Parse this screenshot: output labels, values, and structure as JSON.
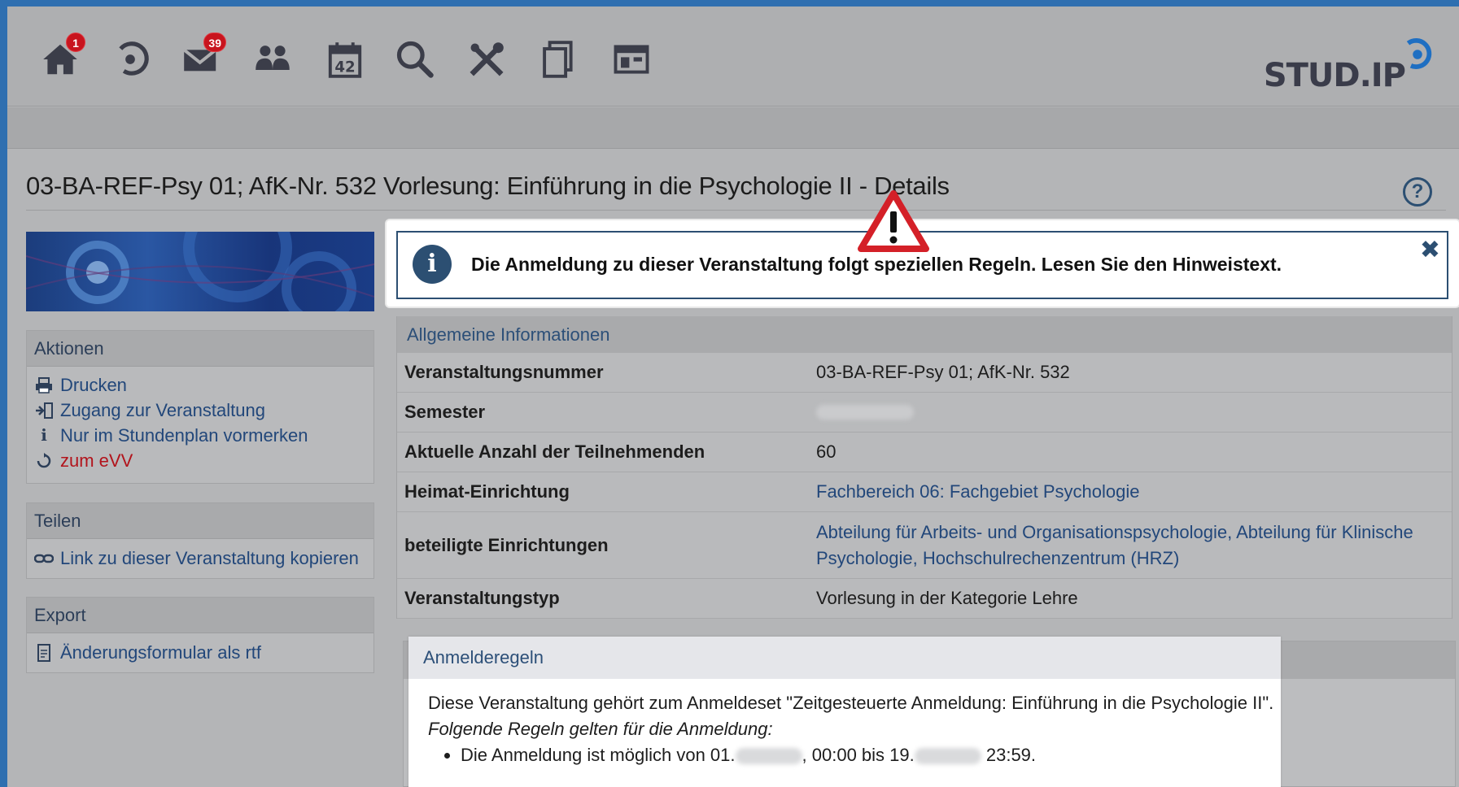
{
  "nav": {
    "items": [
      {
        "name": "home-icon",
        "badge": "1"
      },
      {
        "name": "activity-icon",
        "badge": ""
      },
      {
        "name": "mail-icon",
        "badge": "39"
      },
      {
        "name": "community-icon",
        "badge": ""
      },
      {
        "name": "calendar-icon",
        "badge": "42"
      },
      {
        "name": "search-icon",
        "badge": ""
      },
      {
        "name": "tools-icon",
        "badge": ""
      },
      {
        "name": "files-icon",
        "badge": ""
      },
      {
        "name": "layout-icon",
        "badge": ""
      }
    ],
    "logo_text": "STUD.IP"
  },
  "page": {
    "title": "03-BA-REF-Psy 01; AfK-Nr. 532 Vorlesung: Einführung in die Psychologie II - Details",
    "help_symbol": "?"
  },
  "sidebar": {
    "actions": {
      "title": "Aktionen",
      "items": [
        {
          "label": "Drucken",
          "icon": "print-icon"
        },
        {
          "label": "Zugang zur Veranstaltung",
          "icon": "enter-icon"
        },
        {
          "label": "Nur im Stundenplan vormerken",
          "icon": "info-icon"
        },
        {
          "label": "zum eVV",
          "icon": "refresh-icon"
        }
      ]
    },
    "share": {
      "title": "Teilen",
      "items": [
        {
          "label": "Link zu dieser Veranstaltung kopieren",
          "icon": "link-icon"
        }
      ]
    },
    "export": {
      "title": "Export",
      "items": [
        {
          "label": "Änderungsformular als rtf",
          "icon": "file-icon"
        }
      ]
    }
  },
  "alert": {
    "text": "Die Anmeldung zu dieser Veranstaltung folgt speziellen Regeln. Lesen Sie den Hinweistext.",
    "info_symbol": "i",
    "close_symbol": "✖"
  },
  "info": {
    "caption": "Allgemeine Informationen",
    "rows": [
      {
        "label": "Veranstaltungsnummer",
        "value": "03-BA-REF-Psy 01; AfK-Nr. 532"
      },
      {
        "label": "Semester",
        "value": ""
      },
      {
        "label": "Aktuelle Anzahl der Teilnehmenden",
        "value": "60"
      },
      {
        "label": "Heimat-Einrichtung",
        "value": "Fachbereich 06: Fachgebiet Psychologie"
      },
      {
        "label": "beteiligte Einrichtungen",
        "value": "Abteilung für Arbeits- und Organisationspsychologie, Abteilung für Klinische Psychologie, Hochschulrechenzentrum (HRZ)"
      },
      {
        "label": "Veranstaltungstyp",
        "value": "Vorlesung in der Kategorie Lehre"
      }
    ]
  },
  "rules": {
    "title": "Anmelderegeln",
    "line1": "Diese Veranstaltung gehört zum Anmeldeset \"Zeitgesteuerte Anmeldung: Einführung in die Psychologie II\".",
    "line2": "Folgende Regeln gelten für die Anmeldung:",
    "bullet_part1": "Die Anmeldung ist möglich von 01.",
    "bullet_part2": ", 00:00 bis 19.",
    "bullet_part3": " 23:59."
  },
  "colors": {
    "accent": "#2c4f72",
    "link": "#22477a",
    "badge": "#c8141e",
    "warning": "#d42028"
  }
}
